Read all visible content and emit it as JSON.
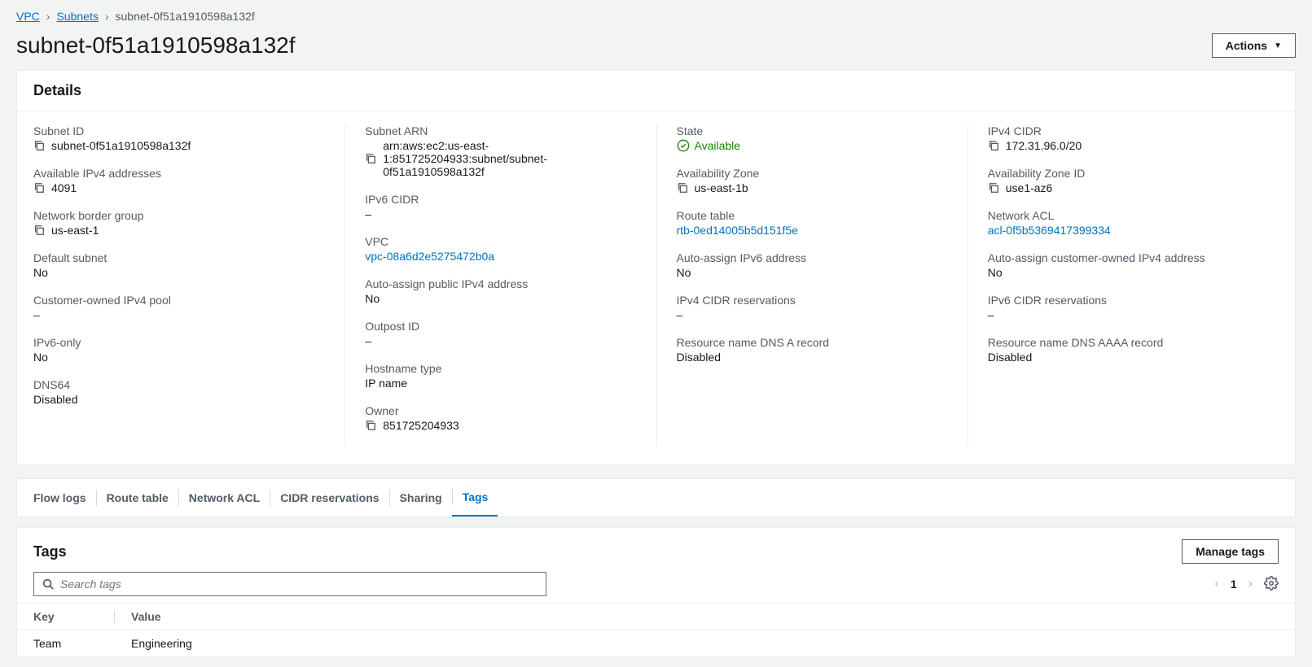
{
  "breadcrumb": {
    "root": "VPC",
    "second": "Subnets",
    "current": "subnet-0f51a1910598a132f"
  },
  "header": {
    "title": "subnet-0f51a1910598a132f",
    "actions_label": "Actions"
  },
  "details": {
    "title": "Details",
    "col1": [
      {
        "label": "Subnet ID",
        "value": "subnet-0f51a1910598a132f",
        "copy": true
      },
      {
        "label": "Available IPv4 addresses",
        "value": "4091",
        "copy": true
      },
      {
        "label": "Network border group",
        "value": "us-east-1",
        "copy": true
      },
      {
        "label": "Default subnet",
        "value": "No"
      },
      {
        "label": "Customer-owned IPv4 pool",
        "value": "–"
      },
      {
        "label": "IPv6-only",
        "value": "No"
      },
      {
        "label": "DNS64",
        "value": "Disabled"
      }
    ],
    "col2": [
      {
        "label": "Subnet ARN",
        "value": "arn:aws:ec2:us-east-1:851725204933:subnet/subnet-0f51a1910598a132f",
        "copy": true
      },
      {
        "label": "IPv6 CIDR",
        "value": "–"
      },
      {
        "label": "VPC",
        "value": "vpc-08a6d2e5275472b0a",
        "link": true
      },
      {
        "label": "Auto-assign public IPv4 address",
        "value": "No"
      },
      {
        "label": "Outpost ID",
        "value": "–"
      },
      {
        "label": "Hostname type",
        "value": "IP name"
      },
      {
        "label": "Owner",
        "value": "851725204933",
        "copy": true
      }
    ],
    "col3": [
      {
        "label": "State",
        "value": "Available",
        "status": true
      },
      {
        "label": "Availability Zone",
        "value": "us-east-1b",
        "copy": true
      },
      {
        "label": "Route table",
        "value": "rtb-0ed14005b5d151f5e",
        "link": true
      },
      {
        "label": "Auto-assign IPv6 address",
        "value": "No"
      },
      {
        "label": "IPv4 CIDR reservations",
        "value": "–"
      },
      {
        "label": "Resource name DNS A record",
        "value": "Disabled"
      }
    ],
    "col4": [
      {
        "label": "IPv4 CIDR",
        "value": "172.31.96.0/20",
        "copy": true
      },
      {
        "label": "Availability Zone ID",
        "value": "use1-az6",
        "copy": true
      },
      {
        "label": "Network ACL",
        "value": "acl-0f5b5369417399334",
        "link": true
      },
      {
        "label": "Auto-assign customer-owned IPv4 address",
        "value": "No"
      },
      {
        "label": "IPv6 CIDR reservations",
        "value": "–"
      },
      {
        "label": "Resource name DNS AAAA record",
        "value": "Disabled"
      }
    ]
  },
  "tabs": [
    {
      "label": "Flow logs",
      "active": false
    },
    {
      "label": "Route table",
      "active": false
    },
    {
      "label": "Network ACL",
      "active": false
    },
    {
      "label": "CIDR reservations",
      "active": false
    },
    {
      "label": "Sharing",
      "active": false
    },
    {
      "label": "Tags",
      "active": true
    }
  ],
  "tags": {
    "title": "Tags",
    "manage_label": "Manage tags",
    "search_placeholder": "Search tags",
    "page": "1",
    "columns": {
      "key": "Key",
      "value": "Value"
    },
    "rows": [
      {
        "key": "Team",
        "value": "Engineering"
      }
    ]
  }
}
